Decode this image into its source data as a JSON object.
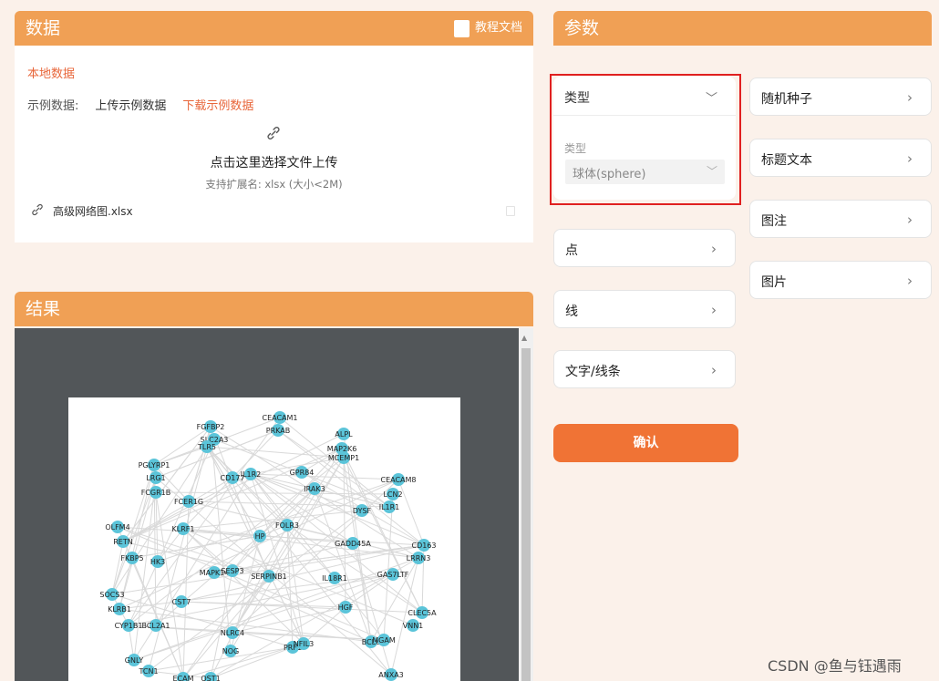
{
  "data_panel": {
    "title": "数据",
    "doc_link": "教程文档",
    "local_data": "本地数据",
    "sample_label": "示例数据:",
    "upload_sample": "上传示例数据",
    "download_sample": "下载示例数据",
    "upload_prompt": "点击这里选择文件上传",
    "upload_hint": "支持扩展名: xlsx (大小<2M)",
    "file_name": "高级网络图.xlsx",
    "icons": {
      "doc": "pdf-icon",
      "upload": "link-icon",
      "file": "link-icon",
      "delete": "trash-icon"
    }
  },
  "result_panel": {
    "title": "结果",
    "network": {
      "nodes": [
        "CEACAM1",
        "FGFBP2",
        "PRKAB",
        "SLC2A3",
        "TLR5",
        "ALPL",
        "MAP2K6",
        "MCEMP1",
        "PGLYRP1",
        "LRG1",
        "FCGR1B",
        "CD177",
        "IL1R2",
        "GPR84",
        "IRAK3",
        "CEACAM8",
        "LCN2",
        "FCER1G",
        "DYSF",
        "IL1R1",
        "OLFM4",
        "RETN",
        "KLRF1",
        "HP",
        "FOLR3",
        "GADD45A",
        "CD163",
        "FKBP5",
        "HK3",
        "LRRN3",
        "MAPK14",
        "SESP3",
        "SERPINB1",
        "IL18R1",
        "GAS7LTF",
        "SOCS3",
        "KLRB1",
        "CST7",
        "HGF",
        "CLEC5A",
        "CYP1B1",
        "BCL2A1",
        "NLRC4",
        "VNN1",
        "GNLY",
        "NOG",
        "PRF1",
        "NFIL3",
        "BCL6",
        "MGAM",
        "TCN1",
        "ECAM",
        "OST1",
        "ANXA3"
      ]
    }
  },
  "params_panel": {
    "title": "参数",
    "type_section": {
      "label": "类型",
      "field_label": "类型",
      "selected_value": "球体(sphere)"
    },
    "sections_left": [
      {
        "label": "点"
      },
      {
        "label": "线"
      },
      {
        "label": "文字/线条"
      }
    ],
    "sections_right": [
      {
        "label": "随机种子"
      },
      {
        "label": "标题文本"
      },
      {
        "label": "图注"
      },
      {
        "label": "图片"
      }
    ],
    "confirm": "确认"
  },
  "colors": {
    "header_bg": "#f0a055",
    "accent": "#e8663a",
    "confirm_bg": "#f07335",
    "highlight_border": "#e02020",
    "node": "#5bc4d9"
  },
  "watermark": "CSDN @鱼与钰遇雨"
}
